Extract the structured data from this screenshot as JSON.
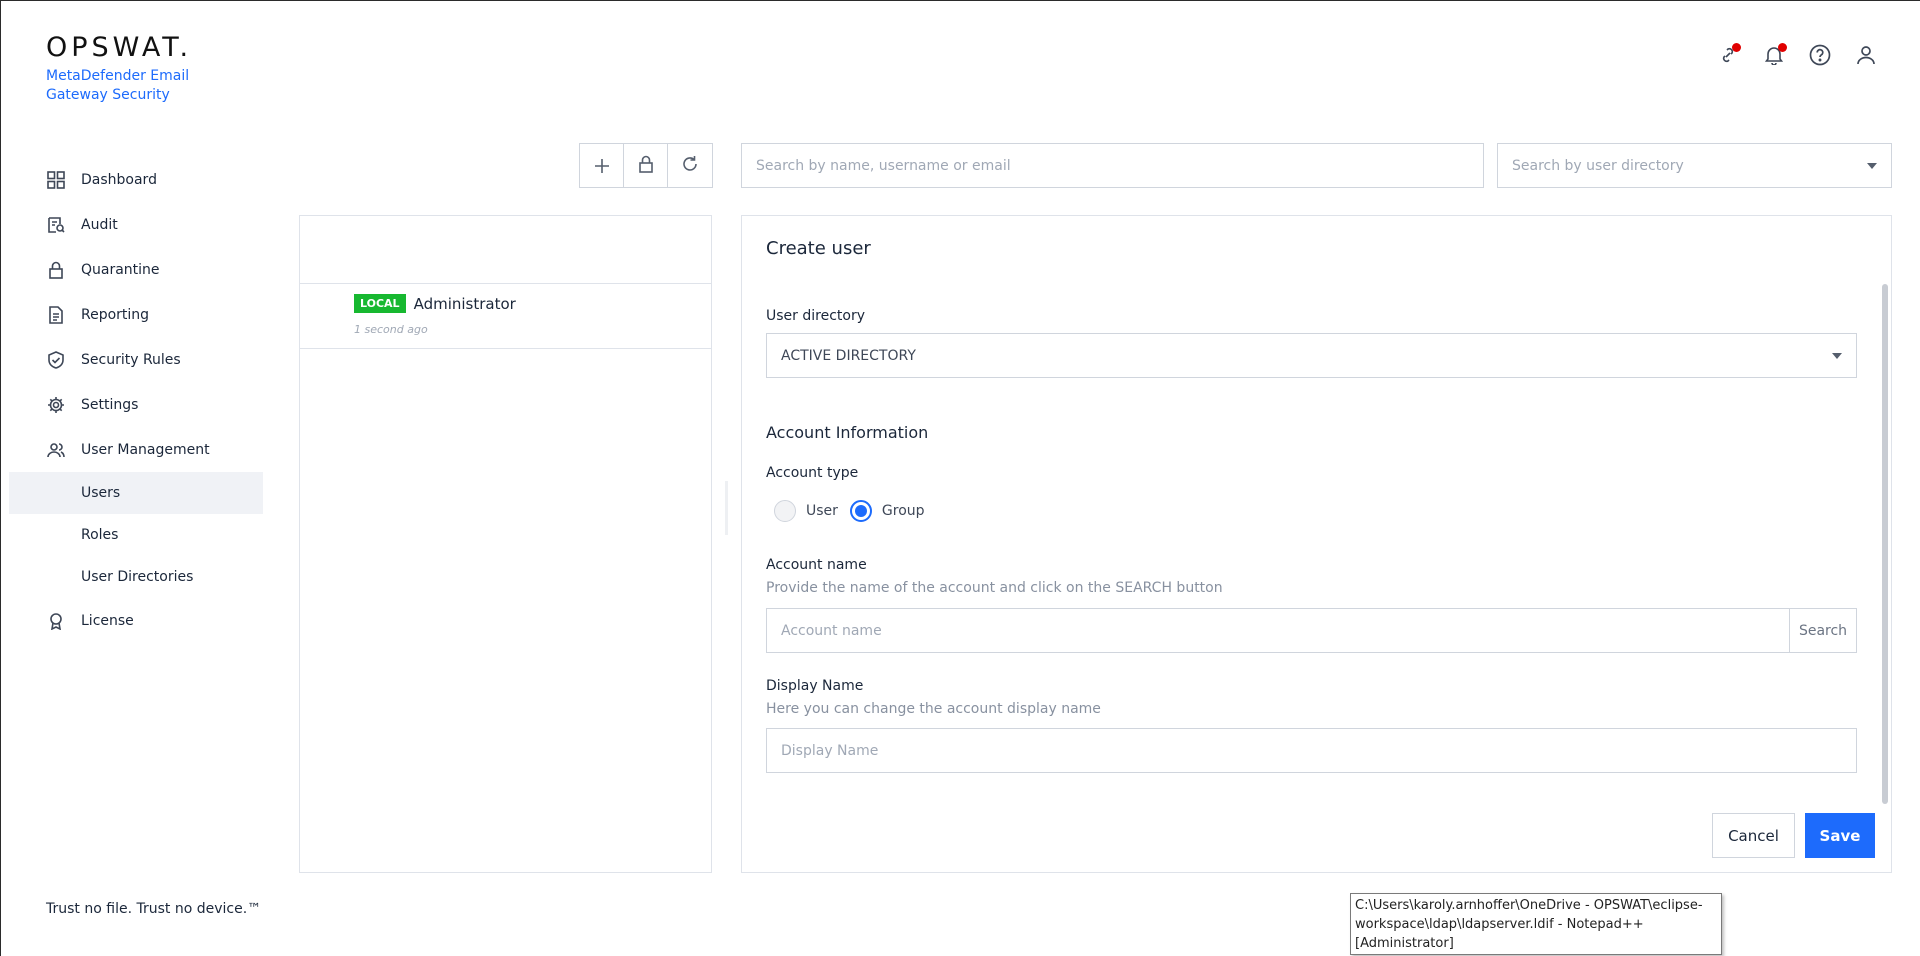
{
  "brand": {
    "logo": "OPSWAT.",
    "product": "MetaDefender Email Gateway Security",
    "tagline": "Trust no file. Trust no device.™"
  },
  "nav": {
    "items": [
      {
        "label": "Dashboard",
        "icon": "grid-icon"
      },
      {
        "label": "Audit",
        "icon": "audit-icon"
      },
      {
        "label": "Quarantine",
        "icon": "lock-icon"
      },
      {
        "label": "Reporting",
        "icon": "document-icon"
      },
      {
        "label": "Security Rules",
        "icon": "shield-check-icon"
      },
      {
        "label": "Settings",
        "icon": "gear-icon"
      },
      {
        "label": "User Management",
        "icon": "users-icon"
      }
    ],
    "sub_items": [
      {
        "label": "Users",
        "active": true
      },
      {
        "label": "Roles"
      },
      {
        "label": "User Directories"
      }
    ],
    "license": {
      "label": "License",
      "icon": "award-icon"
    }
  },
  "header": {
    "icons": [
      "link-icon",
      "bell-icon",
      "help-icon",
      "user-icon"
    ],
    "notification_color": "#e00000"
  },
  "toolbar": {
    "buttons": [
      "add-icon",
      "lock-icon",
      "refresh-icon"
    ],
    "search_placeholder": "Search by name, username or email",
    "directory_placeholder": "Search by user directory"
  },
  "users": [
    {
      "badge": "LOCAL",
      "name": "Administrator",
      "time": "1 second ago"
    }
  ],
  "form": {
    "title": "Create user",
    "user_directory_label": "User directory",
    "user_directory_value": "ACTIVE DIRECTORY",
    "account_info_heading": "Account Information",
    "account_type_label": "Account type",
    "account_type_options": [
      "User",
      "Group"
    ],
    "account_type_selected": "Group",
    "account_name_label": "Account name",
    "account_name_hint": "Provide the name of the account and click on the SEARCH button",
    "account_name_placeholder": "Account name",
    "search_button": "Search",
    "display_name_label": "Display Name",
    "display_name_hint": "Here you can change the account display name",
    "display_name_placeholder": "Display Name",
    "cancel": "Cancel",
    "save": "Save"
  },
  "tooltip": {
    "text": "C:\\Users\\karoly.arnhoffer\\OneDrive - OPSWAT\\eclipse-workspace\\ldap\\ldapserver.ldif - Notepad++ [Administrator]"
  },
  "colors": {
    "accent": "#1d6bfc",
    "local_badge": "#17b830"
  }
}
